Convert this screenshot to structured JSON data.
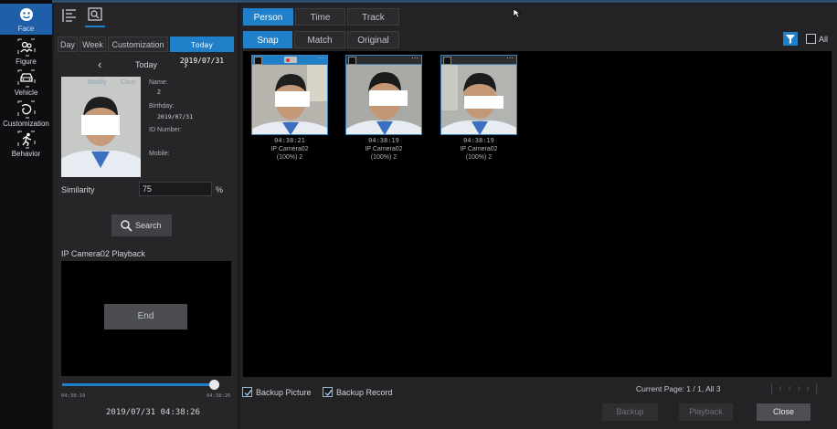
{
  "nav": [
    {
      "label": "Face",
      "icon": "face-icon"
    },
    {
      "label": "Figure",
      "icon": "figure-icon"
    },
    {
      "label": "Vehicle",
      "icon": "vehicle-icon"
    },
    {
      "label": "Customization",
      "icon": "customization-icon"
    },
    {
      "label": "Behavior",
      "icon": "behavior-icon"
    }
  ],
  "left": {
    "range_tabs": [
      "Day",
      "Week",
      "Customization",
      "Today 2019/07/31"
    ],
    "today_label": "Today",
    "face_actions": {
      "modify": "Modify",
      "clear": "Clear"
    },
    "fields": {
      "name_label": "Name:",
      "name_value": "2",
      "birthday_label": "Birthday:",
      "birthday_value": "2019/07/31",
      "id_label": "ID Number:",
      "mobile_label": "Mobile:"
    },
    "similarity_label": "Similarity",
    "similarity_value": "75",
    "similarity_unit": "%",
    "search_label": "Search",
    "playback_title": "IP Camera02 Playback",
    "end_label": "End",
    "timeline_start": "04:38:19",
    "timeline_end": "04:38:26",
    "timeline_progress": 0.98,
    "timestamp": "2019/07/31 04:38:26"
  },
  "right": {
    "view_tabs": [
      "Person",
      "Time",
      "Track"
    ],
    "mode_tabs": [
      "Snap",
      "Match",
      "Original"
    ],
    "all_label": "All",
    "cards": [
      {
        "time": "04:38:21",
        "camera": "IP Camera02",
        "score": "(100%) 2",
        "selected": true
      },
      {
        "time": "04:38:19",
        "camera": "IP Camera02",
        "score": "(100%) 2",
        "selected": false
      },
      {
        "time": "04:38:19",
        "camera": "IP Camera02",
        "score": "(100%) 2",
        "selected": false
      }
    ],
    "backup_picture": "Backup Picture",
    "backup_record": "Backup Record",
    "page_info": "Current Page: 1 / 1, All 3",
    "buttons": {
      "backup": "Backup",
      "playback": "Playback",
      "close": "Close"
    }
  },
  "colors": {
    "accent": "#1f7fc8",
    "nav_active": "#1f5fa8"
  }
}
